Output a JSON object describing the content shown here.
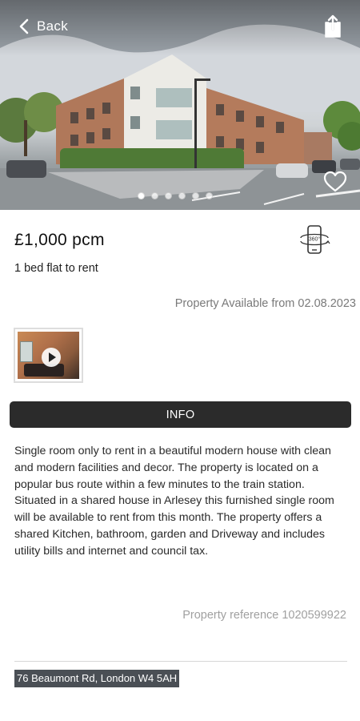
{
  "header": {
    "back_label": "Back"
  },
  "gallery": {
    "dot_count": 6,
    "active_dot_index": 0
  },
  "listing": {
    "price": "£1,000 pcm",
    "subtitle": "1 bed flat to rent",
    "availability": "Property Available from 02.08.2023",
    "info_label": "INFO",
    "description": "Single room only to rent in a beautiful modern house with clean and modern facilities and decor. The property is located on a popular bus route within a few minutes to the train station. Situated in a shared house in Arlesey this furnished single room will be available to rent from this month. The property offers a shared Kitchen, bathroom, garden and Driveway and includes utility bills and internet and council tax.",
    "reference": "Property reference 1020599922",
    "address": "76 Beaumont Rd, London W4 5AH",
    "vr_badge_text": "360°"
  },
  "icons": {
    "back": "chevron-left-icon",
    "share": "share-icon",
    "favourite": "heart-outline-icon",
    "vr": "phone-360-icon",
    "play": "play-icon"
  },
  "colors": {
    "info_bar": "#2b2b2b",
    "address_highlight": "#4a4f55",
    "muted_text": "#7a7a7a",
    "reference_text": "#a0a0a0"
  }
}
